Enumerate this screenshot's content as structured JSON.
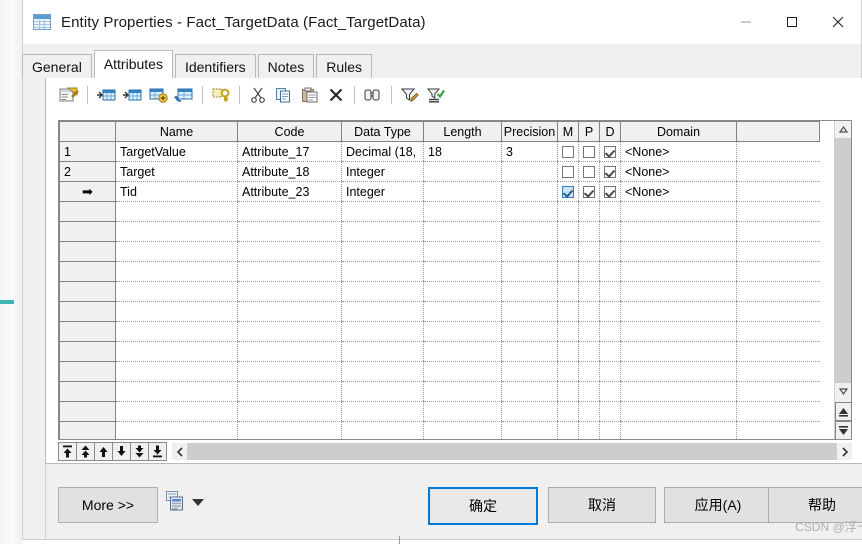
{
  "window": {
    "title": "Entity Properties - Fact_TargetData (Fact_TargetData)",
    "icon": "table-icon",
    "minimize": "minimize-icon",
    "maximize": "maximize-icon",
    "close": "close-icon"
  },
  "tabs": [
    {
      "label": "General",
      "active": false
    },
    {
      "label": "Attributes",
      "active": true
    },
    {
      "label": "Identifiers",
      "active": false
    },
    {
      "label": "Notes",
      "active": false
    },
    {
      "label": "Rules",
      "active": false
    }
  ],
  "toolbar": {
    "items": [
      {
        "name": "properties-icon",
        "tip": "Properties"
      },
      {
        "name": "insert-row-icon",
        "tip": "Insert a Row"
      },
      {
        "name": "add-row-icon",
        "tip": "Add a Row"
      },
      {
        "name": "add-attribute-icon",
        "tip": "Add Attribute"
      },
      {
        "name": "replicate-icon",
        "tip": "Replicate"
      },
      {
        "name": "primary-key-icon",
        "tip": "Primary Key"
      },
      {
        "name": "cut-icon",
        "tip": "Cut"
      },
      {
        "name": "copy-icon",
        "tip": "Copy"
      },
      {
        "name": "paste-icon",
        "tip": "Paste"
      },
      {
        "name": "delete-icon",
        "tip": "Delete"
      },
      {
        "name": "find-icon",
        "tip": "Find"
      },
      {
        "name": "filter-edit-icon",
        "tip": "Customize Filter"
      },
      {
        "name": "filter-apply-icon",
        "tip": "Apply Filter"
      }
    ]
  },
  "grid": {
    "columns": [
      "",
      "Name",
      "Code",
      "Data Type",
      "Length",
      "Precision",
      "M",
      "P",
      "D",
      "Domain",
      ""
    ],
    "rows": [
      {
        "num": "1",
        "current": false,
        "name": "TargetValue",
        "code": "Attribute_17",
        "data_type": "Decimal (18,",
        "length": "18",
        "precision": "3",
        "m": false,
        "p": false,
        "d": true,
        "m_selected": false,
        "domain": "<None>"
      },
      {
        "num": "2",
        "current": false,
        "name": "Target",
        "code": "Attribute_18",
        "data_type": "Integer",
        "length": "",
        "precision": "",
        "m": false,
        "p": false,
        "d": true,
        "m_selected": false,
        "domain": "<None>"
      },
      {
        "num": "➡",
        "current": true,
        "name": "Tid",
        "code": "Attribute_23",
        "data_type": "Integer",
        "length": "",
        "precision": "",
        "m": true,
        "p": true,
        "d": true,
        "m_selected": true,
        "domain": "<None>"
      }
    ],
    "empty_row_count": 12
  },
  "grid_nav": {
    "buttons": [
      {
        "name": "move-to-top-button",
        "glyph": "top"
      },
      {
        "name": "move-up-fast-button",
        "glyph": "upfast"
      },
      {
        "name": "move-up-button",
        "glyph": "up"
      },
      {
        "name": "move-down-button",
        "glyph": "down"
      },
      {
        "name": "move-down-fast-button",
        "glyph": "downfast"
      },
      {
        "name": "move-to-bottom-button",
        "glyph": "bottom"
      }
    ]
  },
  "scrollbar": {
    "up": "scroll-up-icon",
    "down": "scroll-down-icon",
    "first": "scroll-first-icon",
    "last": "scroll-last-icon",
    "left": "scroll-left-icon",
    "right": "scroll-right-icon"
  },
  "footer": {
    "more_label": "More >>",
    "report_icon": "report-icon",
    "report_caret": "dropdown-caret-icon",
    "ok_label": "确定",
    "cancel_label": "取消",
    "apply_label": "应用(A)",
    "help_label": "帮助",
    "watermark": "CSDN @浮千Z"
  },
  "colors": {
    "accent": "#0078d7",
    "selection": "#cce4f7",
    "header_bg": "#f0f0f0"
  }
}
